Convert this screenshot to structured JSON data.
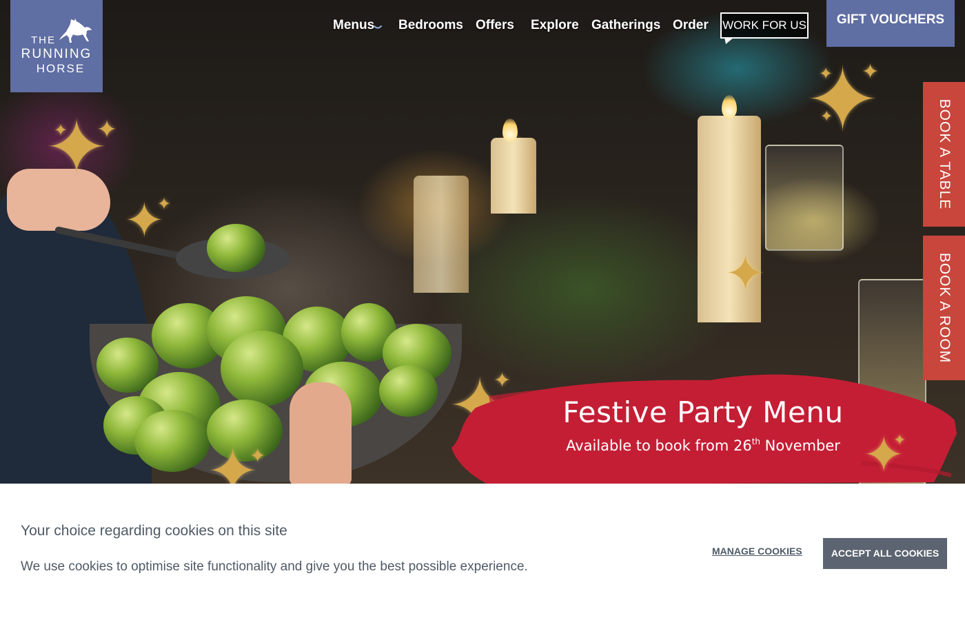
{
  "logo": {
    "line1": "THE",
    "line2": "RUNNING",
    "line3": "HORSE"
  },
  "nav": {
    "items": [
      {
        "label": "Menus",
        "has_dropdown": true
      },
      {
        "label": "Bedrooms"
      },
      {
        "label": "Offers"
      },
      {
        "label": "Explore"
      },
      {
        "label": "Gatherings"
      },
      {
        "label": "Order"
      }
    ],
    "work_for_us": "WORK FOR US",
    "gift_vouchers": "GIFT VOUCHERS"
  },
  "side_tabs": {
    "book_table": "BOOK A TABLE",
    "book_room": "BOOK A ROOM"
  },
  "hero": {
    "title": "Festive Party Menu",
    "subtitle_pre": "Available to book from 26",
    "subtitle_sup": "th",
    "subtitle_post": " November"
  },
  "cookie": {
    "title": "Your choice regarding cookies on this site",
    "text": "We use cookies to optimise site functionality and give you the best possible experience.",
    "manage_label": "MANAGE COOKIES",
    "accept_label": "ACCEPT ALL COOKIES"
  },
  "colors": {
    "brand_blue": "#5f6ea3",
    "book_red": "#c8463c",
    "banner_red": "#c41e35",
    "accept_gray": "#5b6470",
    "sparkle_gold": "#d4a84b"
  },
  "icons": {
    "logo_mark": "horse-icon",
    "dropdown": "chevron-down-icon",
    "decoration": "sparkle-icon"
  }
}
